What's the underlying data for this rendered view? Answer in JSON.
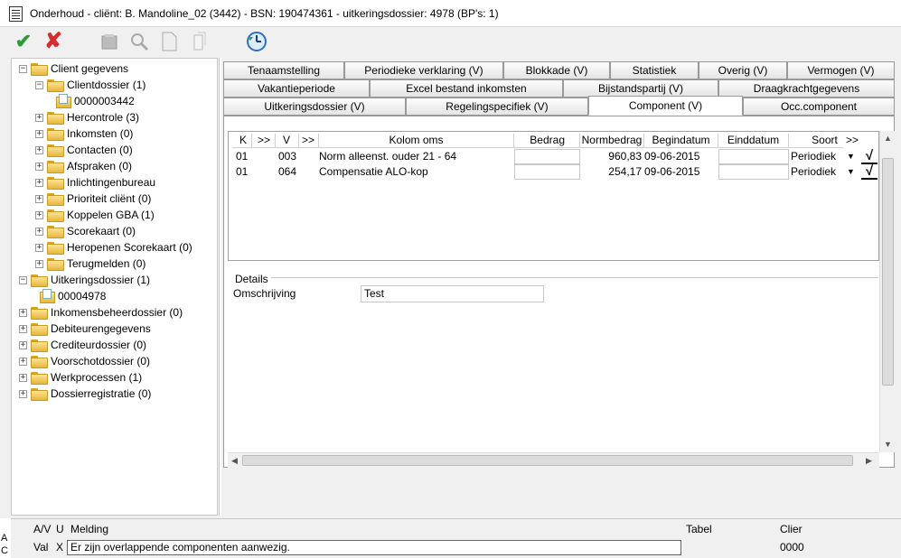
{
  "window": {
    "title": "Onderhoud - cliënt:  B. Mandoline_02 (3442) - BSN: 190474361 - uitkeringsdossier: 4978 (BP's: 1)"
  },
  "toolbar": {
    "icons": [
      "check-icon",
      "cross-icon",
      "delete-icon",
      "search-icon",
      "document-icon",
      "copy-icon",
      "refresh-clock-icon"
    ]
  },
  "tree": {
    "items": [
      {
        "label": "Client gegevens",
        "exp": "−"
      },
      {
        "label": "Clientdossier (1)",
        "exp": "−"
      },
      {
        "label": "0000003442",
        "exp": ""
      },
      {
        "label": "Hercontrole (3)",
        "exp": "+"
      },
      {
        "label": "Inkomsten (0)",
        "exp": "+"
      },
      {
        "label": "Contacten (0)",
        "exp": "+"
      },
      {
        "label": "Afspraken (0)",
        "exp": "+"
      },
      {
        "label": "Inlichtingenbureau",
        "exp": "+"
      },
      {
        "label": "Prioriteit cliënt (0)",
        "exp": "+"
      },
      {
        "label": "Koppelen GBA (1)",
        "exp": "+"
      },
      {
        "label": "Scorekaart (0)",
        "exp": "+"
      },
      {
        "label": "Heropenen Scorekaart (0)",
        "exp": "+"
      },
      {
        "label": "Terugmelden (0)",
        "exp": "+"
      },
      {
        "label": "Uitkeringsdossier (1)",
        "exp": "−"
      },
      {
        "label": "00004978",
        "exp": ""
      },
      {
        "label": "Inkomensbeheerdossier (0)",
        "exp": "+"
      },
      {
        "label": "Debiteurengegevens",
        "exp": "+"
      },
      {
        "label": "Crediteurdossier (0)",
        "exp": "+"
      },
      {
        "label": "Voorschotdossier (0)",
        "exp": "+"
      },
      {
        "label": "Werkprocessen (1)",
        "exp": "+"
      },
      {
        "label": "Dossierregistratie (0)",
        "exp": "+"
      }
    ]
  },
  "tabs": {
    "row1": [
      "Tenaamstelling",
      "Periodieke verklaring (V)",
      "Blokkade (V)",
      "Statistiek",
      "Overig (V)",
      "Vermogen (V)"
    ],
    "row2": [
      "Vakantieperiode",
      "Excel bestand inkomsten",
      "Bijstandspartij (V)",
      "Draagkrachtgegevens"
    ],
    "row3": [
      "Uitkeringsdossier (V)",
      "Regelingspecifiek (V)",
      "Component (V)",
      "Occ.component"
    ],
    "active": "Component (V)"
  },
  "grid": {
    "headers": [
      "K",
      ">>",
      "V",
      ">>",
      "Kolom oms",
      "Bedrag",
      "Normbedrag",
      "Begindatum",
      "Einddatum",
      "Soort",
      ">>"
    ],
    "rows": [
      {
        "k": "01",
        "v": "003",
        "oms": "Norm alleenst. ouder 21 - 64",
        "bedrag": "",
        "norm": "960,83",
        "begin": "09-06-2015",
        "eind": "",
        "soort": "Periodiek",
        "check": "√"
      },
      {
        "k": "01",
        "v": "064",
        "oms": "Compensatie ALO-kop",
        "bedrag": "",
        "norm": "254,17",
        "begin": "09-06-2015",
        "eind": "",
        "soort": "Periodiek",
        "check": "√"
      }
    ]
  },
  "details": {
    "legend": "Details",
    "label": "Omschrijving",
    "value": "Test"
  },
  "messages": {
    "side": [
      "A",
      "C"
    ],
    "headers": {
      "av": "A/V",
      "u": "U",
      "melding": "Melding",
      "tabel": "Tabel",
      "client": "Clier"
    },
    "row": {
      "av": "Val",
      "u": "X",
      "melding": "Er zijn overlappende componenten aanwezig.",
      "tabel": "",
      "client": "0000"
    }
  },
  "colors": {
    "accent": "#2e7d32",
    "cross": "#d32f2f",
    "folder": "#e6b83a"
  }
}
